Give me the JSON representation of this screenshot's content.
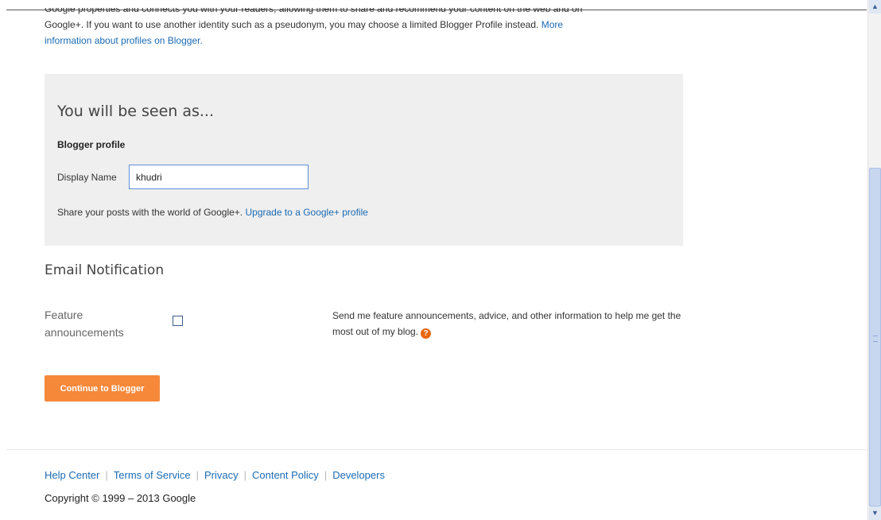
{
  "intro": {
    "line1": "Google properties and connects you with your readers, allowing them to share and recommend your content on the web and on",
    "line2": "Google+. If you want to use another identity such as a pseudonym, you may choose a limited Blogger Profile instead.",
    "more_link_part1": "More",
    "more_link_part2": "information about profiles on Blogger."
  },
  "profile_box": {
    "heading": "You will be seen as...",
    "profile_type": "Blogger profile",
    "display_name_label": "Display Name",
    "display_name_value": "khudri",
    "share_text": "Share your posts with the world of Google+.",
    "upgrade_link": "Upgrade to a Google+ profile"
  },
  "email_notification": {
    "heading": "Email Notification",
    "feature_label": "Feature announcements",
    "feature_checked": false,
    "feature_description": "Send me feature announcements, advice, and other information to help me get the most out of my blog.",
    "help_icon": "question-icon",
    "help_icon_color": "#e8670c"
  },
  "actions": {
    "continue_label": "Continue to Blogger",
    "continue_color": "#f6883a"
  },
  "footer": {
    "links": [
      "Help Center",
      "Terms of Service",
      "Privacy",
      "Content Policy",
      "Developers"
    ],
    "separator": "|",
    "copyright": "Copyright © 1999 – 2013 Google"
  },
  "colors": {
    "link": "#1c6bb3",
    "panel_background": "#efefef"
  }
}
